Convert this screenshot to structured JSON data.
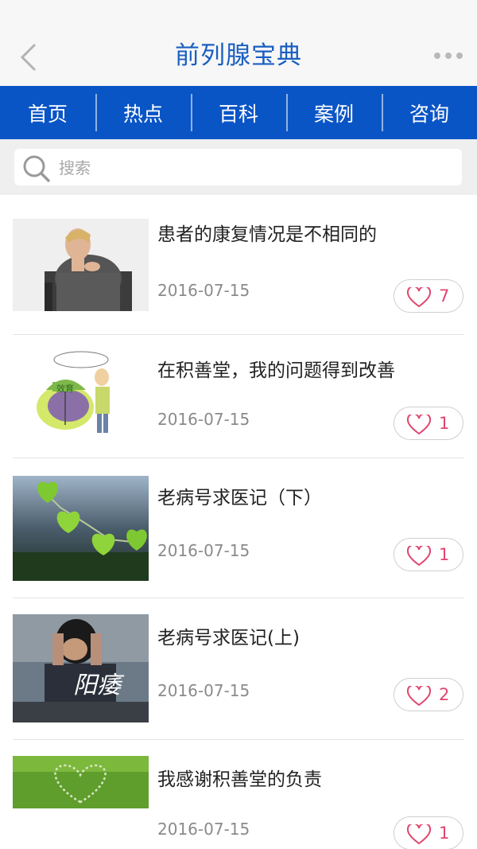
{
  "header": {
    "title": "前列腺宝典"
  },
  "nav": {
    "items": [
      "首页",
      "热点",
      "百科",
      "案例",
      "咨询"
    ]
  },
  "search": {
    "placeholder": "搜索"
  },
  "articles": [
    {
      "title": "患者的康复情况是不相同的",
      "date": "2016-07-15",
      "likes": "7",
      "image": "man-in-wheelchair-thinking"
    },
    {
      "title": "在积善堂，我的问题得到改善",
      "date": "2016-07-15",
      "likes": "1",
      "image": "cartoon-man-with-umbrella"
    },
    {
      "title": "老病号求医记（下）",
      "date": "2016-07-15",
      "likes": "1",
      "image": "green-heart-leaves-chain"
    },
    {
      "title": "老病号求医记(上)",
      "date": "2016-07-15",
      "likes": "2",
      "image": "stressed-man-holding-head"
    },
    {
      "title": "我感谢积善堂的负责",
      "date": "2016-07-15",
      "likes": "1",
      "image": "heart-shape-on-grass"
    }
  ],
  "article_image_labels": {
    "thumb2_badge": "效育",
    "thumb4_overlay": "阳痿"
  },
  "colors": {
    "brand_blue": "#0a55c6",
    "title_blue": "#1b5fc1",
    "like_pink": "#e0466f"
  }
}
